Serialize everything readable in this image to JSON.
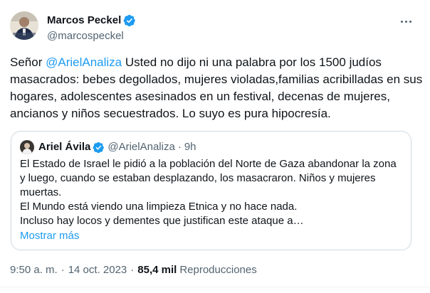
{
  "author": {
    "display_name": "Marcos Peckel",
    "handle": "@marcospeckel",
    "verified_icon": "verified-badge-icon",
    "avatar_icon": "avatar-image"
  },
  "more_icon": "more-options-icon",
  "tweet": {
    "prefix": "Señor ",
    "mention": "@ArielAnaliza",
    "body": " Usted no dijo ni una palabra por los 1500 judíos masacrados: bebes degollados, mujeres violadas,familias acribilladas en sus hogares, adolescentes asesinados en un festival, decenas de mujeres, ancianos y niños secuestrados. Lo suyo es pura hipocresía."
  },
  "quoted": {
    "display_name": "Ariel Ávila",
    "handle": "@ArielAnaliza",
    "separator": "·",
    "time": "9h",
    "lines": [
      "El Estado de Israel le pidió a la población del Norte de Gaza abandonar la zona",
      "y luego, cuando se estaban desplazando, los masacraron. Niños y mujeres",
      "muertas.",
      "El Mundo está viendo una limpieza Etnica y no hace nada.",
      "Incluso hay locos y dementes que justifican este ataque a…"
    ],
    "show_more": "Mostrar más"
  },
  "meta": {
    "time": "9:50 a. m.",
    "separator": "·",
    "date": "14 oct. 2023",
    "views_count": "85,4 mil",
    "views_label": "Reproducciones"
  },
  "colors": {
    "accent": "#1d9bf0",
    "text": "#0f1419",
    "secondary": "#536471",
    "border": "#cfd9de"
  }
}
